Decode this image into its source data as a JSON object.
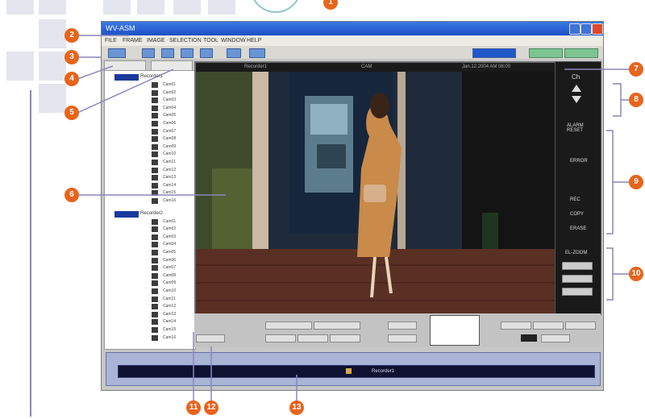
{
  "window": {
    "title": "WV-ASM",
    "menus": [
      "FILE",
      "FRAME",
      "IMAGE",
      "SELECTION",
      "TOOL",
      "WINDOW",
      "HELP"
    ],
    "tree_tabs": [
      "",
      ""
    ],
    "tree_groups": [
      "Recorder1",
      "Recorder2"
    ],
    "tree_items": [
      "Cam01",
      "Cam02",
      "Cam03",
      "Cam04",
      "Cam05",
      "Cam06",
      "Cam07",
      "Cam08",
      "Cam09",
      "Cam10",
      "Cam11",
      "Cam12",
      "Cam13",
      "Cam14",
      "Cam15",
      "Cam16"
    ]
  },
  "viewer": {
    "info_left": "Recorder1",
    "info_mid": "CAM",
    "info_right": "Jan.12.2004 AM 08:00"
  },
  "right_panel": {
    "ch": "Ch",
    "alarm_reset": "ALARM RESET",
    "error": "ERROR",
    "rec": "REC",
    "copy": "COPY",
    "erase": "ERASE",
    "el_zoom": "EL-ZOOM"
  },
  "bottom": {
    "left_label": "",
    "right_label": ""
  },
  "status": {
    "left": "",
    "mid": "Recorder1",
    "right": ""
  },
  "callouts": [
    "1",
    "2",
    "3",
    "4",
    "5",
    "6",
    "7",
    "8",
    "9",
    "10",
    "11",
    "12",
    "13"
  ],
  "colors": {
    "callout": "#e8641b",
    "titlebar": "#1d4fc7",
    "bracket": "#8a86bd"
  }
}
